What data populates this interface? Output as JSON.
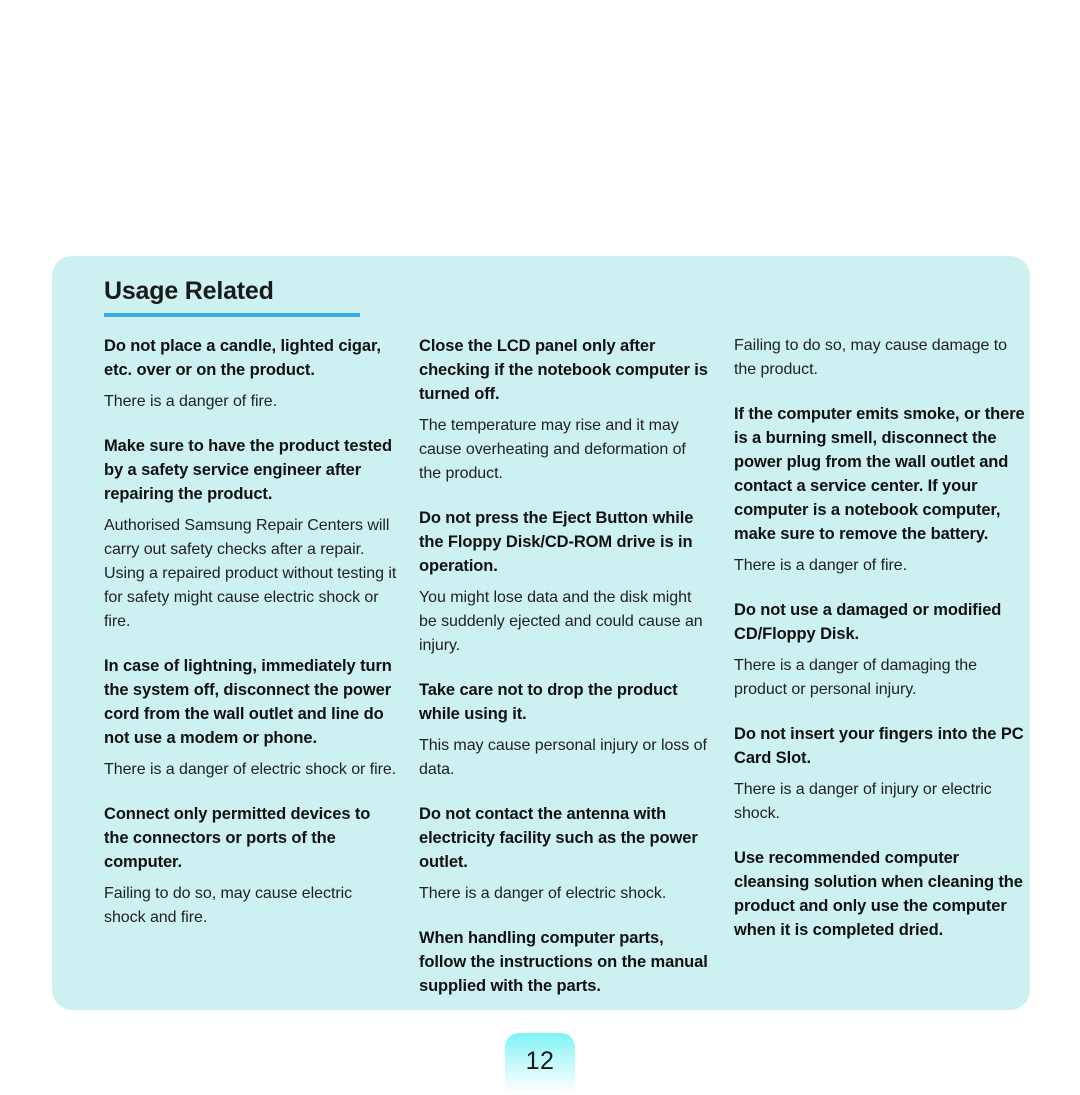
{
  "page": {
    "number": "12",
    "panel_bg": "#cdf1f0",
    "rule_color": "#3ca9e2",
    "text_color": "#1a1a1a"
  },
  "panel": {
    "title": "Usage Related"
  },
  "columns": [
    {
      "entries": [
        {
          "title": "Do not place a candle, lighted cigar, etc. over or on the product.",
          "body": "There is a danger of fire."
        },
        {
          "title": "Make sure to have the product tested by a safety service engineer after repairing the product.",
          "body": "Authorised Samsung Repair Centers will carry out safety checks after a repair. Using a repaired product without testing it for safety might cause electric shock or fire."
        },
        {
          "title": "In case of lightning, immediately turn the system off, disconnect the power cord from the wall outlet and line do not use a modem or phone.",
          "body": "There is a danger of electric shock or fire."
        },
        {
          "title": "Connect only permitted devices to the connectors or ports of the computer.",
          "body": "Failing to do so, may cause electric shock and fire."
        }
      ]
    },
    {
      "entries": [
        {
          "title": "Close the LCD panel only after checking if the notebook computer is turned off.",
          "body": "The temperature may rise and it may cause overheating and deformation of the product."
        },
        {
          "title": "Do not press the Eject Button while the Floppy Disk/CD-ROM drive is in operation.",
          "body": "You might lose data and the disk might be suddenly ejected and could cause an injury."
        },
        {
          "title": "Take care not to drop the product while using it.",
          "body": "This may cause personal injury or loss of data."
        },
        {
          "title": "Do not contact the antenna with electricity facility such as the power outlet.",
          "body": "There is a danger of electric shock."
        },
        {
          "title": "When handling computer parts, follow the instructions on the manual supplied with the parts.",
          "body": ""
        }
      ]
    },
    {
      "entries": [
        {
          "title": "",
          "body": "Failing to do so, may cause damage to the product."
        },
        {
          "title": "If the computer emits smoke, or there is a burning smell, disconnect the power plug from the wall outlet and contact a service center. If your computer is a notebook computer, make sure to remove the battery.",
          "body": "There is a danger of fire."
        },
        {
          "title": "Do not use a damaged or modified CD/Floppy Disk.",
          "body": "There is a danger of damaging the product or personal injury."
        },
        {
          "title": "Do not insert your fingers into the PC Card Slot.",
          "body": "There is a danger of injury or electric shock."
        },
        {
          "title": "Use recommended computer cleansing solution when cleaning the product and only use the computer when it is completed dried.",
          "body": ""
        }
      ]
    }
  ]
}
